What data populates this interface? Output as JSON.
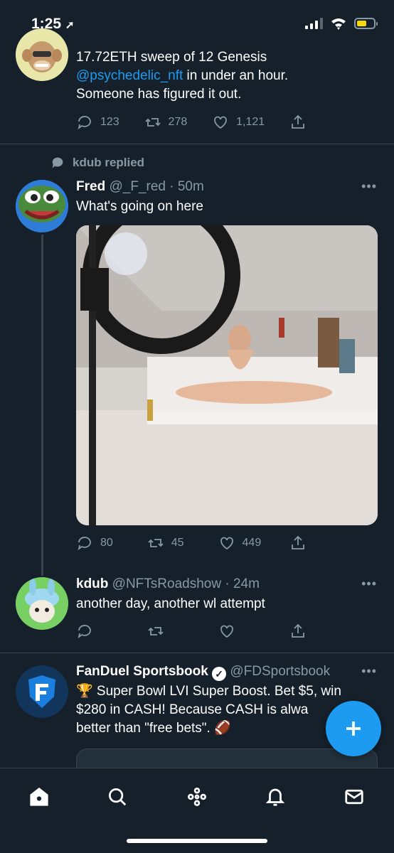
{
  "status_bar": {
    "time": "1:25"
  },
  "tweet1": {
    "text_line1": "17.72ETH sweep of 12 Genesis",
    "mention": "@psychedelic_nft",
    "text_line2_rest": " in under an hour.",
    "text_line3": "Someone has figured it out.",
    "replies": "123",
    "retweets": "278",
    "likes": "1,121"
  },
  "tweet2": {
    "context": "kdub replied",
    "name": "Fred",
    "meta": "@_F_red · 50m",
    "text": "What's going on here",
    "replies": "80",
    "retweets": "45",
    "likes": "449"
  },
  "tweet3": {
    "name": "kdub",
    "meta": "@NFTsRoadshow · 24m",
    "text": "another day, another wl attempt"
  },
  "tweet4": {
    "name": "FanDuel Sportsbook",
    "meta": "@FDSportsbook",
    "text_line1": "🏆 Super Bowl LVI Super Boost. Bet $5, win",
    "text_line2": "$280 in CASH! Because CASH is alwa",
    "text_line3": "better than \"free bets\". 🏈"
  },
  "more_label": "•••",
  "colors": {
    "accent": "#1d9bf0",
    "background": "#15202b",
    "muted": "#8899a6"
  }
}
